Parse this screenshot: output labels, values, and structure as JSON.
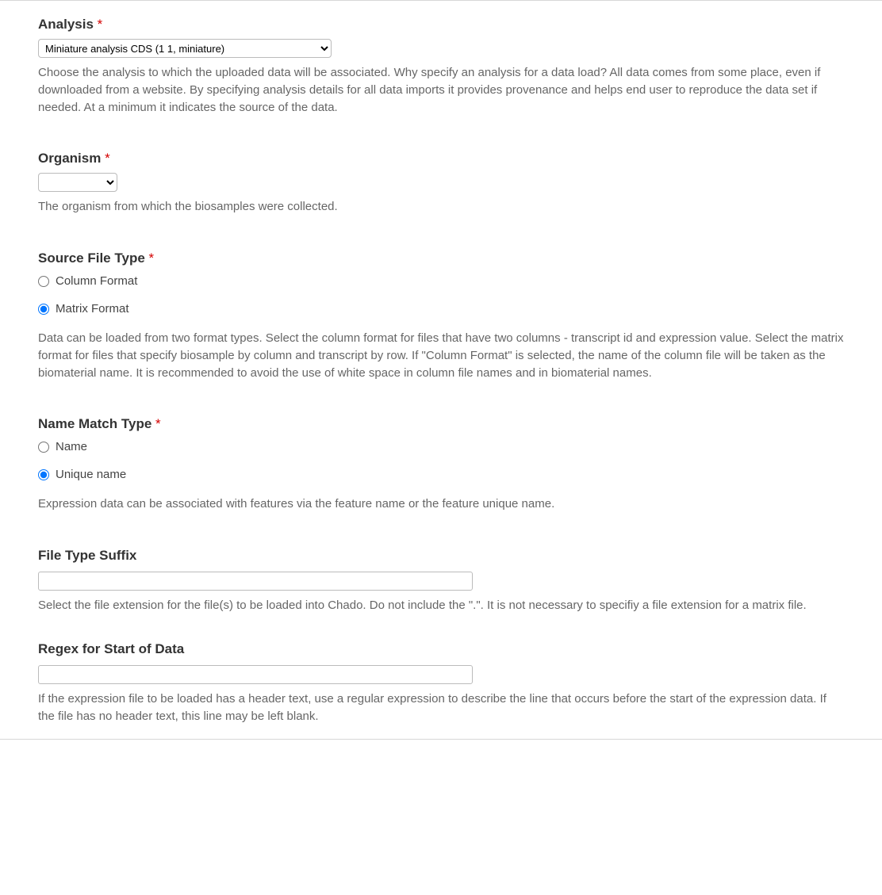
{
  "analysis": {
    "label": "Analysis",
    "required_mark": "*",
    "selected": "Miniature analysis CDS (1 1, miniature)",
    "help": "Choose the analysis to which the uploaded data will be associated. Why specify an analysis for a data load? All data comes from some place, even if downloaded from a website. By specifying analysis details for all data imports it provides provenance and helps end user to reproduce the data set if needed. At a minimum it indicates the source of the data."
  },
  "organism": {
    "label": "Organism",
    "required_mark": "*",
    "selected": "",
    "help": "The organism from which the biosamples were collected."
  },
  "source_file_type": {
    "label": "Source File Type",
    "required_mark": "*",
    "options": {
      "column": "Column Format",
      "matrix": "Matrix Format"
    },
    "help": "Data can be loaded from two format types. Select the column format for files that have two columns - transcript id and expression value. Select the matrix format for files that specify biosample by column and transcript by row. If \"Column Format\" is selected, the name of the column file will be taken as the biomaterial name. It is recommended to avoid the use of white space in column file names and in biomaterial names."
  },
  "name_match_type": {
    "label": "Name Match Type",
    "required_mark": "*",
    "options": {
      "name": "Name",
      "unique": "Unique name"
    },
    "help": "Expression data can be associated with features via the feature name or the feature unique name."
  },
  "file_type_suffix": {
    "label": "File Type Suffix",
    "value": "",
    "help": "Select the file extension for the file(s) to be loaded into Chado. Do not include the \".\". It is not necessary to specifiy a file extension for a matrix file."
  },
  "regex_start": {
    "label": "Regex for Start of Data",
    "value": "",
    "help": "If the expression file to be loaded has a header text, use a regular expression to describe the line that occurs before the start of the expression data. If the file has no header text, this line may be left blank."
  }
}
